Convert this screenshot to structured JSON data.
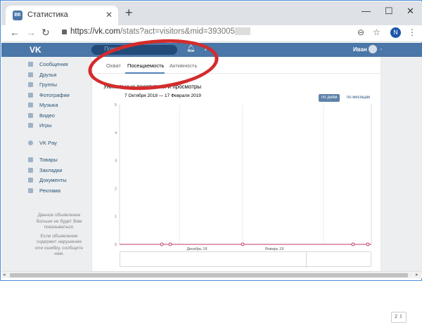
{
  "browser": {
    "tab_title": "Статистика",
    "favicon": "ВК",
    "tab_close": "✕",
    "new_tab": "+",
    "url_main": "https://vk.com",
    "url_path": "/stats?act=visitors&mid=393005",
    "profile_letter": "N",
    "min": "—",
    "max": "☐",
    "close": "✕"
  },
  "vk": {
    "logo": "VK",
    "search_placeholder": "Поиск",
    "user_name": "Иван"
  },
  "sidebar": {
    "items": [
      {
        "label": "Сообщения"
      },
      {
        "label": "Друзья"
      },
      {
        "label": "Группы"
      },
      {
        "label": "Фотографии"
      },
      {
        "label": "Музыка"
      },
      {
        "label": "Видео"
      },
      {
        "label": "Игры"
      },
      {
        "label": ""
      },
      {
        "label": "VK Pay"
      },
      {
        "label": ""
      },
      {
        "label": "Товары"
      },
      {
        "label": "Закладки"
      },
      {
        "label": "Документы"
      },
      {
        "label": "Реклама"
      }
    ],
    "ad_line1": "Данное объявление больше не будет Вам показываться.",
    "ad_line2": "Если объявление содержит нарушение или ошибку, сообщите нам."
  },
  "stats": {
    "tabs": [
      "Охват",
      "Посещаемость",
      "Активность"
    ],
    "active_tab": 1,
    "title": "Уникальные посетители и просмотры",
    "date_range": "7 Октября 2018 — 17 Февраля 2019",
    "btn_days": "по дням",
    "btn_months": "по месяцам",
    "pager": "2 ⇩"
  },
  "chart_data": {
    "type": "line",
    "ylim": [
      0,
      5
    ],
    "yticks": [
      "0",
      "1",
      "2",
      "3",
      "4",
      "5"
    ],
    "xtick_labels": [
      "Декабрь 18",
      "Январь 19"
    ],
    "series": [
      {
        "values": [
          0,
          0,
          0,
          0,
          0,
          0,
          0
        ],
        "color": "#c23a6b"
      }
    ]
  }
}
